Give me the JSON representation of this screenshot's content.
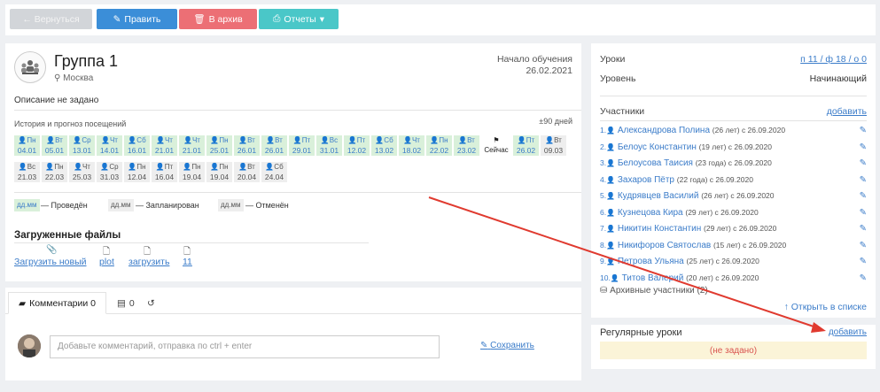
{
  "toolbar": {
    "back": "← Вернуться",
    "edit": "Править",
    "archive": "В архив",
    "reports": "Отчеты"
  },
  "group": {
    "title": "Группа 1",
    "city": "Москва",
    "start_label": "Начало обучения",
    "start_date": "26.02.2021",
    "description": "Описание не задано"
  },
  "attendance": {
    "label": "История и прогноз посещений",
    "days": "±90 дней",
    "now_label": "Сейчас",
    "row1": [
      {
        "d": "Пн",
        "t": "04.01",
        "s": "done"
      },
      {
        "d": "Вт",
        "t": "05.01",
        "s": "done"
      },
      {
        "d": "Ср",
        "t": "13.01",
        "s": "done"
      },
      {
        "d": "Чт",
        "t": "14.01",
        "s": "done"
      },
      {
        "d": "Сб",
        "t": "16.01",
        "s": "done"
      },
      {
        "d": "Чт",
        "t": "21.01",
        "s": "done"
      },
      {
        "d": "Чт",
        "t": "21.01",
        "s": "done"
      },
      {
        "d": "Пн",
        "t": "25.01",
        "s": "done"
      },
      {
        "d": "Вт",
        "t": "26.01",
        "s": "done"
      },
      {
        "d": "Вт",
        "t": "26.01",
        "s": "done"
      },
      {
        "d": "Пт",
        "t": "29.01",
        "s": "done"
      },
      {
        "d": "Вс",
        "t": "31.01",
        "s": "done"
      },
      {
        "d": "Пт",
        "t": "12.02",
        "s": "done"
      },
      {
        "d": "Сб",
        "t": "13.02",
        "s": "done"
      },
      {
        "d": "Чт",
        "t": "18.02",
        "s": "done"
      },
      {
        "d": "Пн",
        "t": "22.02",
        "s": "done"
      },
      {
        "d": "Вт",
        "t": "23.02",
        "s": "done"
      },
      {
        "d": "",
        "t": "",
        "s": "now"
      },
      {
        "d": "Пт",
        "t": "26.02",
        "s": "done"
      },
      {
        "d": "Вт",
        "t": "09.03",
        "s": "plan"
      }
    ],
    "row2": [
      {
        "d": "Вс",
        "t": "21.03",
        "s": "plan"
      },
      {
        "d": "Пн",
        "t": "22.03",
        "s": "plan"
      },
      {
        "d": "Чт",
        "t": "25.03",
        "s": "plan"
      },
      {
        "d": "Ср",
        "t": "31.03",
        "s": "plan"
      },
      {
        "d": "Пн",
        "t": "12.04",
        "s": "plan"
      },
      {
        "d": "Пт",
        "t": "16.04",
        "s": "plan"
      },
      {
        "d": "Пн",
        "t": "19.04",
        "s": "plan"
      },
      {
        "d": "Пн",
        "t": "19.04",
        "s": "plan"
      },
      {
        "d": "Вт",
        "t": "20.04",
        "s": "plan"
      },
      {
        "d": "Сб",
        "t": "24.04",
        "s": "plan"
      }
    ],
    "legend": {
      "chip": "дд.мм",
      "done": "— Проведён",
      "planned": "— Запланирован",
      "cancelled": "— Отменён"
    }
  },
  "files": {
    "title": "Загруженные файлы",
    "upload": "Загрузить новый",
    "items": [
      "plot",
      "загрузить",
      "11"
    ]
  },
  "comments": {
    "tab_comments": "Комментарии 0",
    "tab_two": "0",
    "placeholder": "Добавьте комментарий, отправка по ctrl + enter",
    "save": "Сохранить"
  },
  "side": {
    "lessons_label": "Уроки",
    "lessons_value": "п 11 / ф 18 / о 0",
    "level_label": "Уровень",
    "level_value": "Начинающий",
    "participants_label": "Участники",
    "add": "добавить",
    "participants": [
      {
        "n": "1.",
        "name": "Александрова Полина",
        "age": "(26 лет)",
        "since": "с 26.09.2020"
      },
      {
        "n": "2.",
        "name": "Белоус Константин",
        "age": "(19 лет)",
        "since": "с 26.09.2020"
      },
      {
        "n": "3.",
        "name": "Белоусова Таисия",
        "age": "(23 года)",
        "since": "с 26.09.2020"
      },
      {
        "n": "4.",
        "name": "Захаров Пётр",
        "age": "(22 года)",
        "since": "с 26.09.2020"
      },
      {
        "n": "5.",
        "name": "Кудрявцев Василий",
        "age": "(26 лет)",
        "since": "с 26.09.2020"
      },
      {
        "n": "6.",
        "name": "Кузнецова Кира",
        "age": "(29 лет)",
        "since": "с 26.09.2020"
      },
      {
        "n": "7.",
        "name": "Никитин Константин",
        "age": "(29 лет)",
        "since": "с 26.09.2020"
      },
      {
        "n": "8.",
        "name": "Никифоров Святослав",
        "age": "(15 лет)",
        "since": "с 26.09.2020"
      },
      {
        "n": "9.",
        "name": "Петрова Ульяна",
        "age": "(25 лет)",
        "since": "с 26.09.2020"
      },
      {
        "n": "10.",
        "name": "Титов Валерий",
        "age": "(20 лет)",
        "since": "с 26.09.2020"
      }
    ],
    "archived": "Архивные участники (2)",
    "open_list": "Открыть в списке",
    "regular_label": "Регулярные уроки",
    "regular_add": "добавить",
    "not_set": "(не задано)"
  },
  "colors": {
    "accent": "#3b7cc9",
    "edit": "#3b8ed8",
    "archive": "#ec6f75",
    "reports": "#4ac7c8",
    "arrow": "#e03a2f"
  }
}
